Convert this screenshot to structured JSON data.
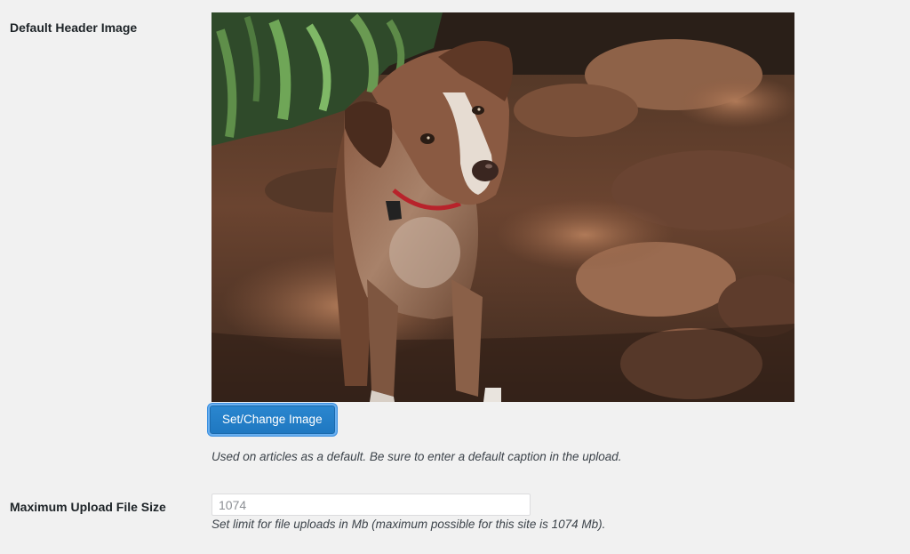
{
  "settings": {
    "header_image": {
      "label": "Default Header Image",
      "image_subject": "dog",
      "button_label": "Set/Change Image",
      "description": "Used on articles as a default. Be sure to enter a default caption in the upload."
    },
    "max_upload": {
      "label": "Maximum Upload File Size",
      "placeholder": "1074",
      "value": "",
      "description": "Set limit for file uploads in Mb (maximum possible for this site is 1074 Mb)."
    }
  },
  "colors": {
    "page_background": "#f1f1f1",
    "button_blue": "#2271b1",
    "button_focus_ring": "#6ab0f0",
    "text": "#1d2327",
    "description_text": "#3c434a",
    "input_border": "#dcdcde"
  }
}
